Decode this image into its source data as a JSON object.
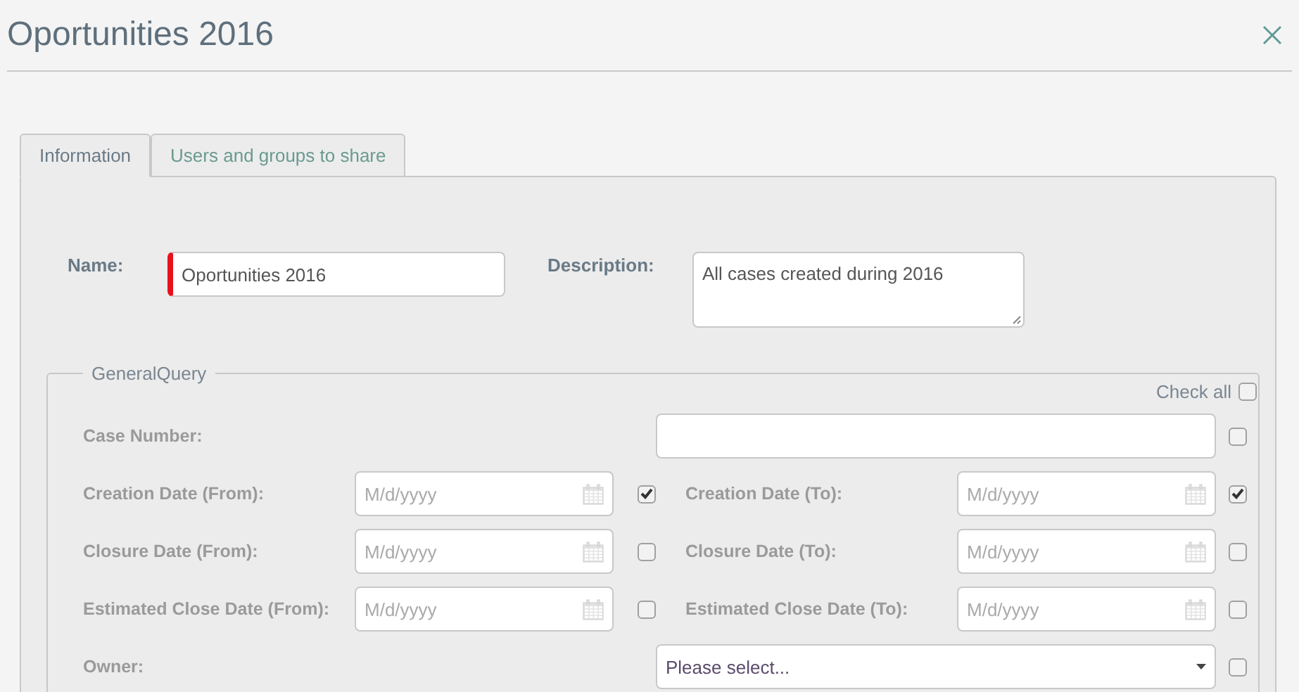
{
  "window": {
    "title": "Oportunities 2016"
  },
  "tabs": [
    {
      "label": "Information",
      "selected": true
    },
    {
      "label": "Users and groups to share",
      "selected": false
    }
  ],
  "name": {
    "label": "Name:",
    "value": "Oportunities 2016",
    "required": true
  },
  "description": {
    "label": "Description:",
    "value": "All cases created during 2016"
  },
  "general_query": {
    "legend": "GeneralQuery",
    "check_all": {
      "label": "Check all",
      "checked": false
    },
    "rows": [
      {
        "kind": "text",
        "label": "Case Number:",
        "checked": false
      },
      {
        "kind": "date-pair",
        "from": {
          "label": "Creation Date (From):",
          "placeholder": "M/d/yyyy",
          "checked": true
        },
        "to": {
          "label": "Creation Date (To):",
          "placeholder": "M/d/yyyy",
          "checked": true
        }
      },
      {
        "kind": "date-pair",
        "from": {
          "label": "Closure Date (From):",
          "placeholder": "M/d/yyyy",
          "checked": false
        },
        "to": {
          "label": "Closure Date (To):",
          "placeholder": "M/d/yyyy",
          "checked": false
        }
      },
      {
        "kind": "date-pair",
        "from": {
          "label": "Estimated Close Date (From):",
          "placeholder": "M/d/yyyy",
          "checked": false
        },
        "to": {
          "label": "Estimated Close Date (To):",
          "placeholder": "M/d/yyyy",
          "checked": false
        }
      },
      {
        "kind": "select",
        "label": "Owner:",
        "value": "Please select...",
        "checked": false
      }
    ]
  }
}
